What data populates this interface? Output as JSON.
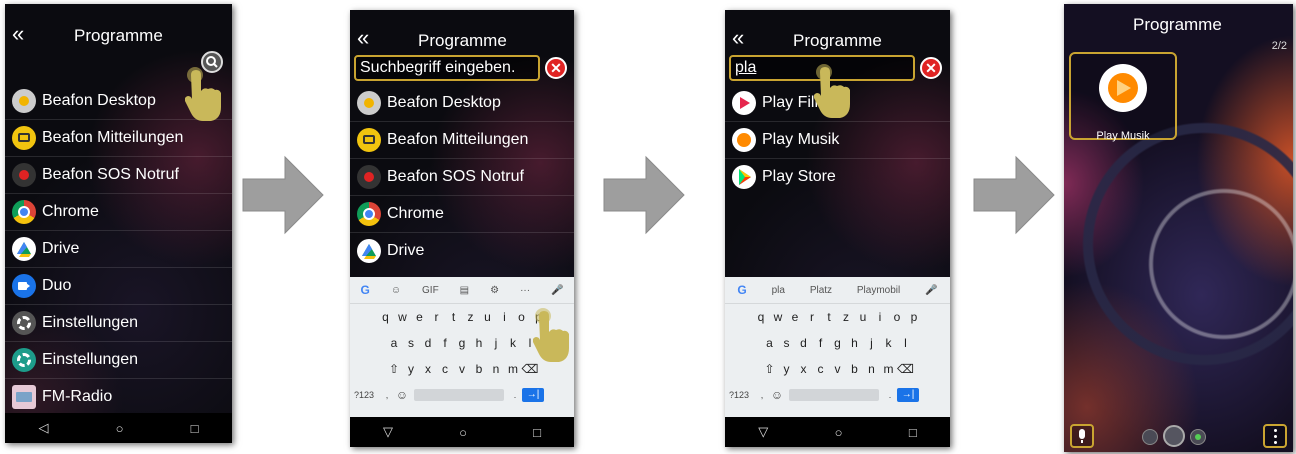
{
  "phone1": {
    "back": "«",
    "title": "Programme",
    "items": [
      {
        "label": "Beafon Desktop"
      },
      {
        "label": "Beafon Mitteilungen"
      },
      {
        "label": "Beafon SOS Notruf"
      },
      {
        "label": "Chrome"
      },
      {
        "label": "Drive"
      },
      {
        "label": "Duo"
      },
      {
        "label": "Einstellungen"
      },
      {
        "label": "Einstellungen"
      },
      {
        "label": "FM-Radio"
      }
    ],
    "nav": [
      "◁",
      "○",
      "□"
    ]
  },
  "phone2": {
    "back": "«",
    "title": "Programme",
    "search_placeholder": "Suchbegriff eingeben.",
    "items": [
      {
        "label": "Beafon Desktop"
      },
      {
        "label": "Beafon Mitteilungen"
      },
      {
        "label": "Beafon SOS Notruf"
      },
      {
        "label": "Chrome"
      },
      {
        "label": "Drive"
      }
    ],
    "keyboard": {
      "toolbar": [
        "G",
        "☺",
        "GIF",
        "▤",
        "⚙",
        "···",
        "🎤"
      ],
      "row1": [
        "q",
        "w",
        "e",
        "r",
        "t",
        "z",
        "u",
        "i",
        "o",
        "p"
      ],
      "row2": [
        "a",
        "s",
        "d",
        "f",
        "g",
        "h",
        "j",
        "k",
        "l"
      ],
      "row3": [
        "⇧",
        "y",
        "x",
        "c",
        "v",
        "b",
        "n",
        "m",
        "⌫"
      ],
      "sym": "?123",
      "comma": ",",
      "emoji": "☺",
      "period": ".",
      "enter": "→|"
    },
    "nav": [
      "▽",
      "○",
      "□"
    ]
  },
  "phone3": {
    "back": "«",
    "title": "Programme",
    "search_value": "pla",
    "items": [
      {
        "label": "Play Filme"
      },
      {
        "label": "Play Musik"
      },
      {
        "label": "Play Store"
      }
    ],
    "keyboard": {
      "suggestions": [
        "pla",
        "Platz",
        "Playmobil"
      ],
      "row1": [
        "q",
        "w",
        "e",
        "r",
        "t",
        "z",
        "u",
        "i",
        "o",
        "p"
      ],
      "row2": [
        "a",
        "s",
        "d",
        "f",
        "g",
        "h",
        "j",
        "k",
        "l"
      ],
      "row3": [
        "⇧",
        "y",
        "x",
        "c",
        "v",
        "b",
        "n",
        "m",
        "⌫"
      ],
      "sym": "?123",
      "comma": ",",
      "emoji": "☺",
      "period": ".",
      "enter": "→|"
    },
    "nav": [
      "▽",
      "○",
      "□"
    ]
  },
  "phone4": {
    "title": "Programme",
    "page": "2/2",
    "tile_label": "Play Musik"
  },
  "colors": {
    "accent": "#c9a431",
    "close": "#e02323",
    "hand": "#c9b85a",
    "arrow": "#9e9e9e"
  }
}
